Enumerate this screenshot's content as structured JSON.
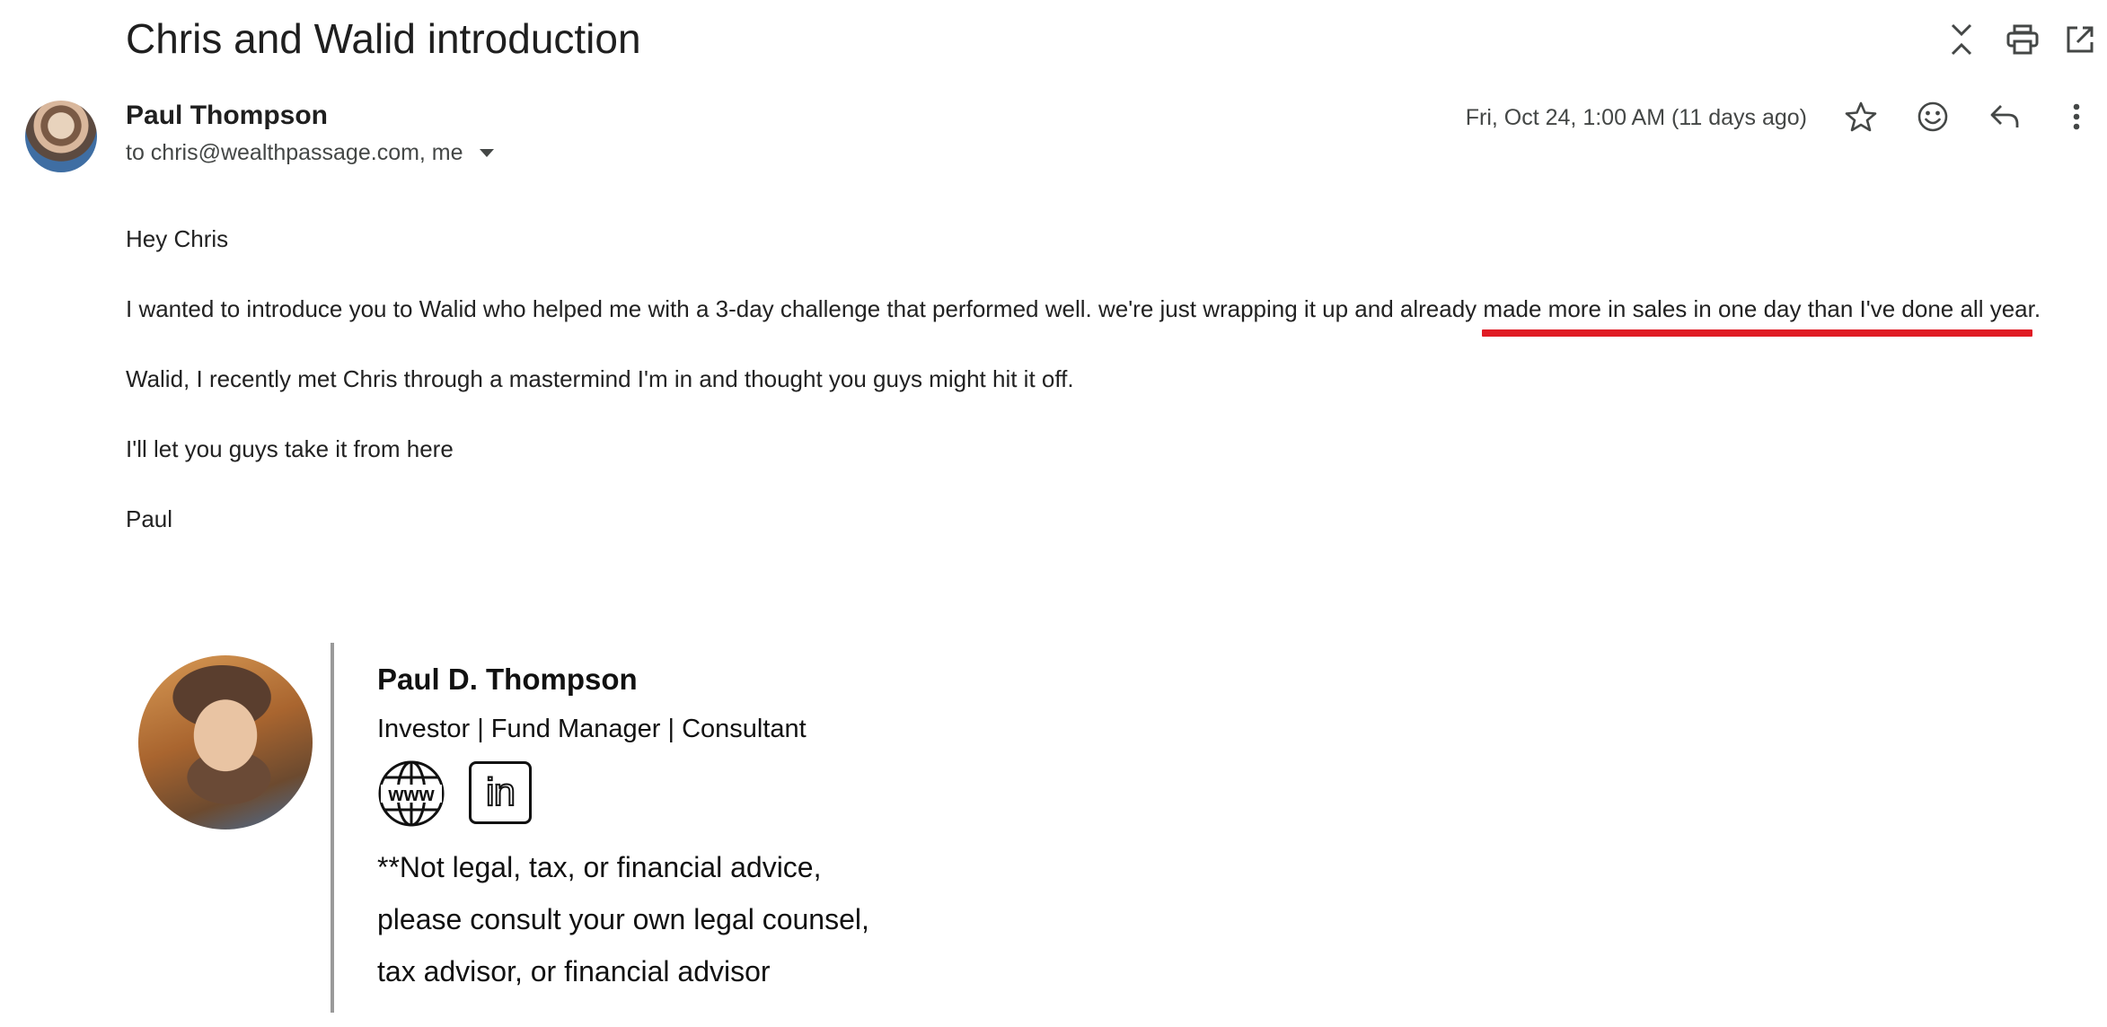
{
  "email": {
    "subject": "Chris and Walid introduction",
    "sender_name": "Paul Thompson",
    "recipients": "to chris@wealthpassage.com, me",
    "timestamp": "Fri, Oct 24, 1:00 AM (11 days ago)"
  },
  "top_actions": {
    "icons": [
      "collapse-all-icon",
      "print-icon",
      "open-in-new-window-icon"
    ]
  },
  "message_actions": {
    "icons": [
      "star-icon",
      "emoji-reaction-icon",
      "reply-icon",
      "more-vert-icon"
    ]
  },
  "body": {
    "greeting": "Hey Chris",
    "para1_main": "I wanted to introduce you to Walid who helped me with a 3-day challenge that performed well. we're just wrapping it up and already ",
    "para1_highlight": "made more in sales in one day than I've done all year.",
    "para2": "Walid, I recently met Chris through a mastermind I'm in and thought you guys might hit it off.",
    "para3": "I'll let you guys take it from here",
    "signoff": "Paul"
  },
  "signature": {
    "name": "Paul D. Thompson",
    "title": "Investor | Fund Manager | Consultant",
    "website_icon_text": "www",
    "linkedin_icon_text": "in",
    "disclaimer_lines": [
      "**Not legal, tax, or financial advice,",
      "please consult your own legal counsel,",
      "tax advisor, or financial advisor"
    ]
  },
  "colors": {
    "highlight_underline": "#e01b24",
    "text_primary": "#1f1f1f",
    "text_secondary": "#444746"
  }
}
